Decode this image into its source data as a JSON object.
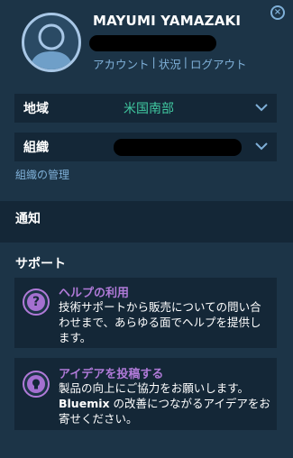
{
  "user": {
    "name": "MAYUMI YAMAZAKI",
    "links": [
      "アカウント",
      "状況",
      "ログアウト"
    ],
    "separator": "|"
  },
  "close": {
    "glyph": "×"
  },
  "region": {
    "label": "地域",
    "value": "米国南部"
  },
  "organization": {
    "label": "組織",
    "value": ""
  },
  "manage_org": {
    "label": "組織の管理"
  },
  "notifications": {
    "title": "通知"
  },
  "support": {
    "title": "サポート",
    "cards": [
      {
        "icon": "help-icon",
        "icon_glyph": "?",
        "title": "ヘルプの利用",
        "body": "技術サポートから販売についての問い合わせまで、あらゆる面でヘルプを提供します。"
      },
      {
        "icon": "lightbulb-icon",
        "title": "アイデアを投稿する",
        "body_prefix": "製品の向上にご協力をお願いします。",
        "body_bold": "Bluemix",
        "body_suffix": " の改善につながるアイデアをお寄せください。"
      }
    ]
  },
  "colors": {
    "background": "#1c3447",
    "row": "#142737",
    "link": "#7fb0d8",
    "accent_green": "#40c8a0",
    "accent_purple": "#b07ad8"
  }
}
